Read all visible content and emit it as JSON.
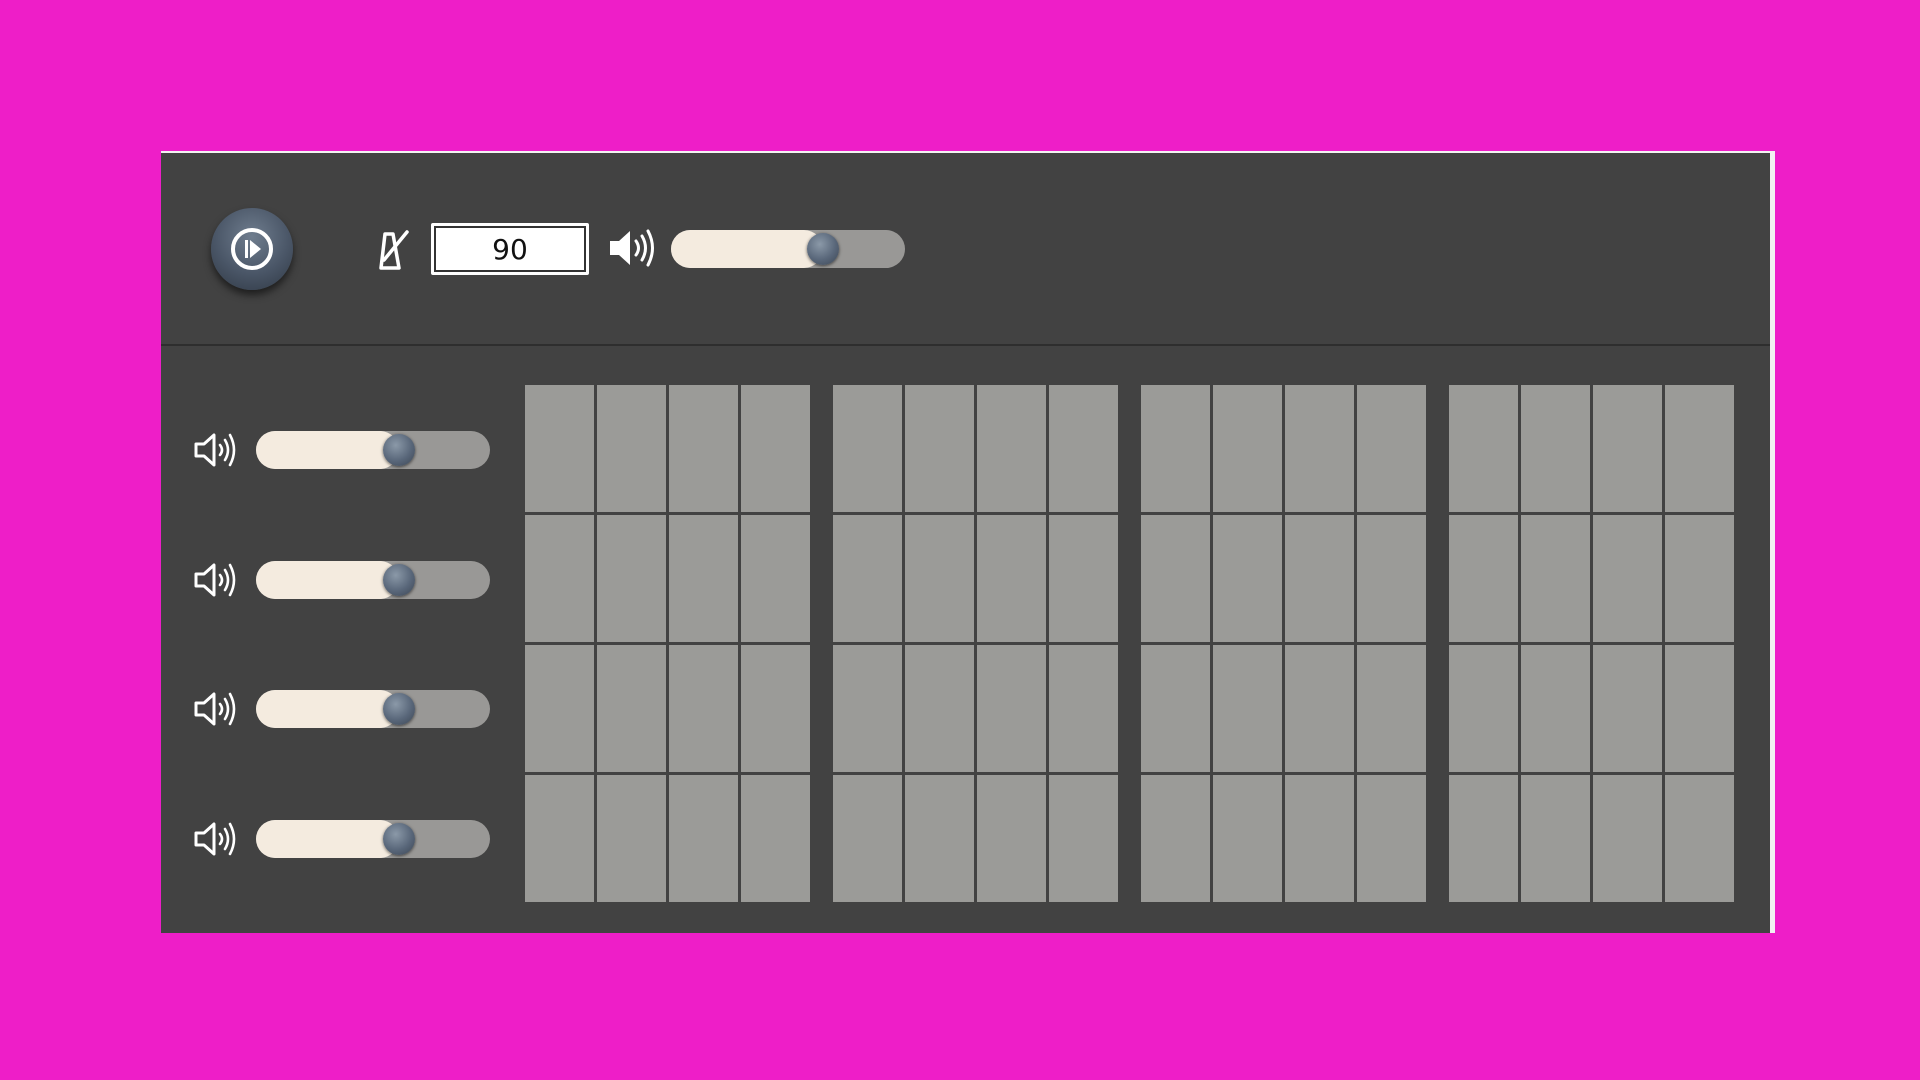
{
  "transport": {
    "play_icon": "play-circle-icon",
    "metronome_icon": "metronome-icon",
    "tempo_value": "90",
    "master_volume_icon": "speaker-volume-icon",
    "master_volume_level": 0.65
  },
  "tracks": [
    {
      "volume_icon": "speaker-volume-icon",
      "volume_level": 0.61
    },
    {
      "volume_icon": "speaker-volume-icon",
      "volume_level": 0.61
    },
    {
      "volume_icon": "speaker-volume-icon",
      "volume_level": 0.61
    },
    {
      "volume_icon": "speaker-volume-icon",
      "volume_level": 0.61
    }
  ],
  "pattern": {
    "bars": 4,
    "steps_per_bar": 4,
    "rows": 4,
    "active_steps": []
  },
  "colors": {
    "background": "#ee1ec8",
    "panel": "#424242",
    "step_off": "#9b9b98",
    "slider_fill": "#f4ebdf",
    "slider_track": "#999896",
    "knob": "#4a5667"
  }
}
